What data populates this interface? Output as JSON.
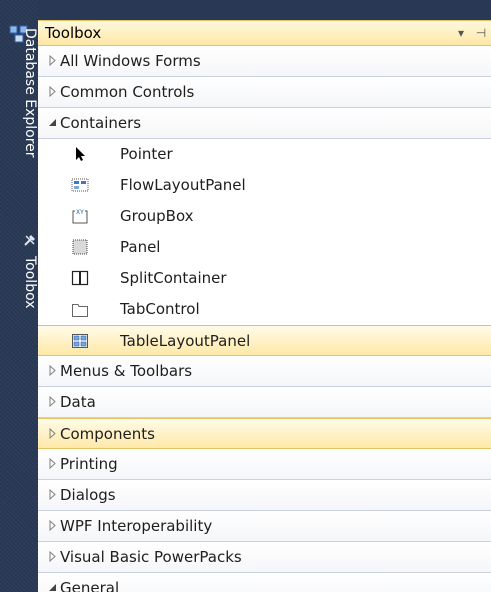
{
  "side_tabs": [
    {
      "label": "Database Explorer",
      "icon": "database-explorer-icon"
    },
    {
      "label": "Toolbox",
      "icon": "toolbox-icon"
    }
  ],
  "toolbox": {
    "title": "Toolbox",
    "buttons": [
      {
        "name": "dropdown-arrow-icon",
        "glyph": "▾"
      },
      {
        "name": "pin-icon",
        "glyph": "⊣"
      }
    ]
  },
  "categories_before": [
    {
      "label": "All Windows Forms",
      "expanded": false
    },
    {
      "label": "Common Controls",
      "expanded": false
    },
    {
      "label": "Containers",
      "expanded": true
    }
  ],
  "container_items": [
    {
      "label": "Pointer",
      "icon": "pointer-icon"
    },
    {
      "label": "FlowLayoutPanel",
      "icon": "flowlayoutpanel-icon"
    },
    {
      "label": "GroupBox",
      "icon": "groupbox-icon"
    },
    {
      "label": "Panel",
      "icon": "panel-icon"
    },
    {
      "label": "SplitContainer",
      "icon": "splitcontainer-icon"
    },
    {
      "label": "TabControl",
      "icon": "tabcontrol-icon"
    },
    {
      "label": "TableLayoutPanel",
      "icon": "tablelayoutpanel-icon",
      "highlighted": true
    }
  ],
  "categories_after": [
    {
      "label": "Menus & Toolbars",
      "expanded": false
    },
    {
      "label": "Data",
      "expanded": false
    },
    {
      "label": "Components",
      "expanded": false,
      "highlighted": true
    },
    {
      "label": "Printing",
      "expanded": false
    },
    {
      "label": "Dialogs",
      "expanded": false
    },
    {
      "label": "WPF Interoperability",
      "expanded": false
    },
    {
      "label": "Visual Basic PowerPacks",
      "expanded": false
    },
    {
      "label": "General",
      "expanded": true
    }
  ],
  "colors": {
    "side_strip": "#293955",
    "highlight": "#ffe9a8",
    "highlight_border": "#e5c365"
  }
}
